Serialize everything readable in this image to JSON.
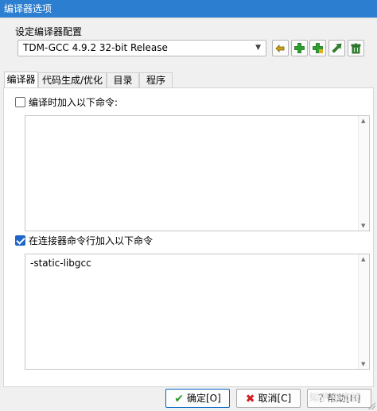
{
  "window": {
    "title": "编译器选项"
  },
  "compiler_set": {
    "group_label": "设定编译器配置",
    "selected": "TDM-GCC 4.9.2 32-bit Release",
    "buttons": [
      {
        "name": "rename-compiler-set-button",
        "icon": "rename-icon",
        "color": "#c9a21a"
      },
      {
        "name": "add-compiler-set-button",
        "icon": "plus-icon",
        "color": "#2ca12c"
      },
      {
        "name": "add-folder-compiler-set-button",
        "icon": "plus-folder-icon",
        "color": "#2ca12c"
      },
      {
        "name": "rename-arrow-button",
        "icon": "arrow-icon",
        "color": "#2f8a2f"
      },
      {
        "name": "delete-compiler-set-button",
        "icon": "trash-icon",
        "color": "#3a8a3a"
      }
    ]
  },
  "tabs": [
    {
      "label": "编译器",
      "active": true
    },
    {
      "label": "代码生成/优化",
      "active": false
    },
    {
      "label": "目录",
      "active": false
    },
    {
      "label": "程序",
      "active": false
    }
  ],
  "compile_commands": {
    "label": "编译时加入以下命令:",
    "checked": false,
    "value": ""
  },
  "linker_commands": {
    "label": "在连接器命令行加入以下命令",
    "checked": true,
    "value": "-static-libgcc"
  },
  "footer": {
    "ok_label": "确定[O]",
    "cancel_label": "取消[C]",
    "help_label": "帮助[H]",
    "watermark": "知乎 @杰拉"
  },
  "colors": {
    "titlebar": "#2c7ed0",
    "checkbox_checked": "#1f66c8",
    "ok_check": "#2c9a2c",
    "cancel_x": "#d02020"
  }
}
